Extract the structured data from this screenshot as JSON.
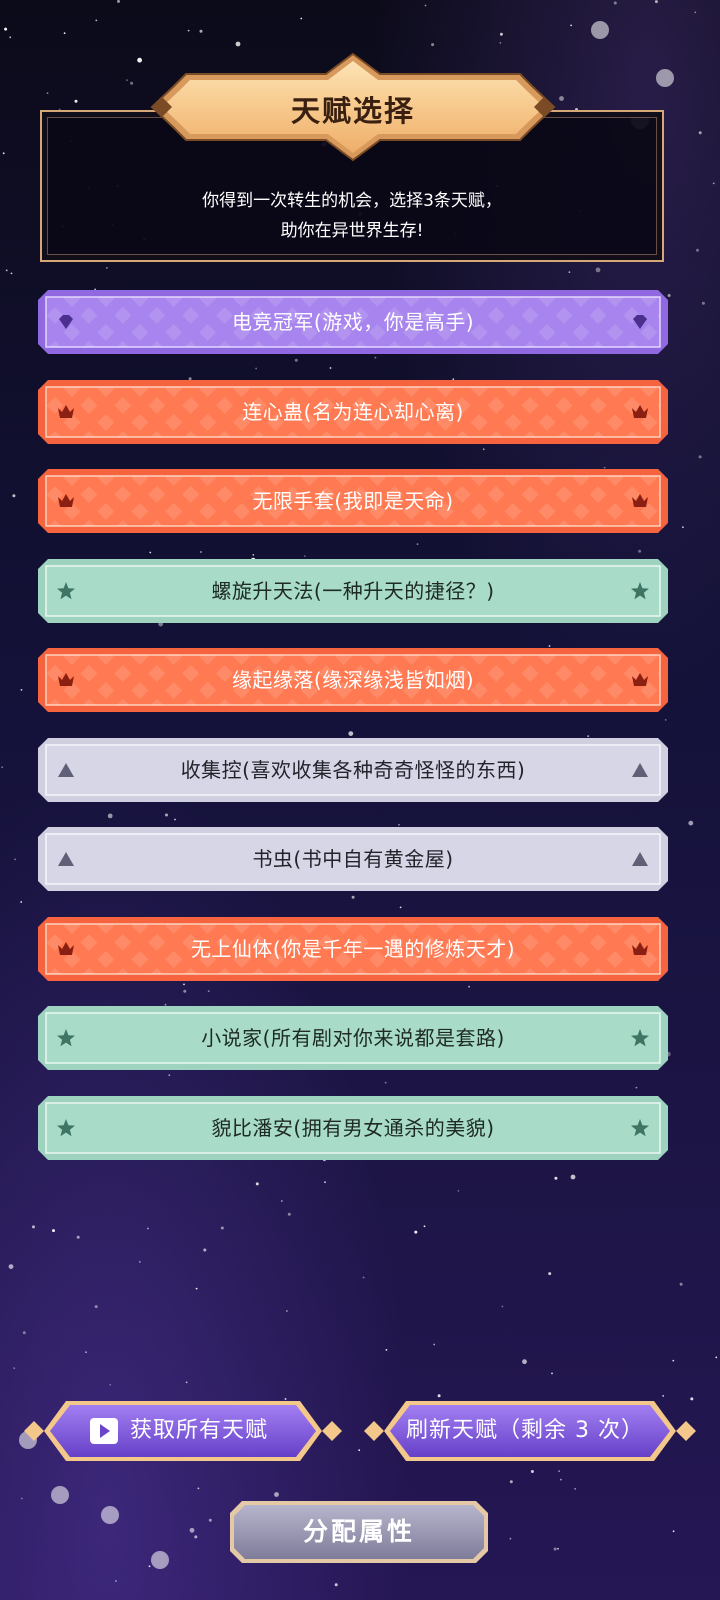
{
  "header": {
    "title": "天赋选择",
    "intro_line_1": "你得到一次转生的机会，选择3条天赋，",
    "intro_line_2": "助你在异世界生存!"
  },
  "talents": [
    {
      "text": "电竞冠军(游戏，你是高手)",
      "rank": "legendary",
      "icon": "diamond-icon"
    },
    {
      "text": "连心蛊(名为连心却心离)",
      "rank": "epic",
      "icon": "crown-icon"
    },
    {
      "text": "无限手套(我即是天命)",
      "rank": "epic",
      "icon": "crown-icon"
    },
    {
      "text": "螺旋升天法(一种升天的捷径？)",
      "rank": "rare",
      "icon": "star-icon"
    },
    {
      "text": "缘起缘落(缘深缘浅皆如烟)",
      "rank": "epic",
      "icon": "crown-icon"
    },
    {
      "text": "收集控(喜欢收集各种奇奇怪怪的东西)",
      "rank": "common",
      "icon": "triangle-icon"
    },
    {
      "text": "书虫(书中自有黄金屋)",
      "rank": "common",
      "icon": "triangle-icon"
    },
    {
      "text": "无上仙体(你是千年一遇的修炼天才)",
      "rank": "epic",
      "icon": "crown-icon"
    },
    {
      "text": "小说家(所有剧对你来说都是套路)",
      "rank": "rare",
      "icon": "star-icon"
    },
    {
      "text": "貌比潘安(拥有男女通杀的美貌)",
      "rank": "rare",
      "icon": "star-icon"
    }
  ],
  "buttons": {
    "get_all_label": "获取所有天赋",
    "get_all_icon": "play-video-icon",
    "refresh_label": "刷新天赋（剩余 3 次）",
    "assign_label": "分配属性"
  },
  "colors": {
    "legendary": "#9068e0",
    "epic": "#f5643e",
    "rare": "#9ed4bf",
    "common": "#cfcfe0",
    "gold": "#f3c88a",
    "button_purple": "#7a55d8"
  }
}
